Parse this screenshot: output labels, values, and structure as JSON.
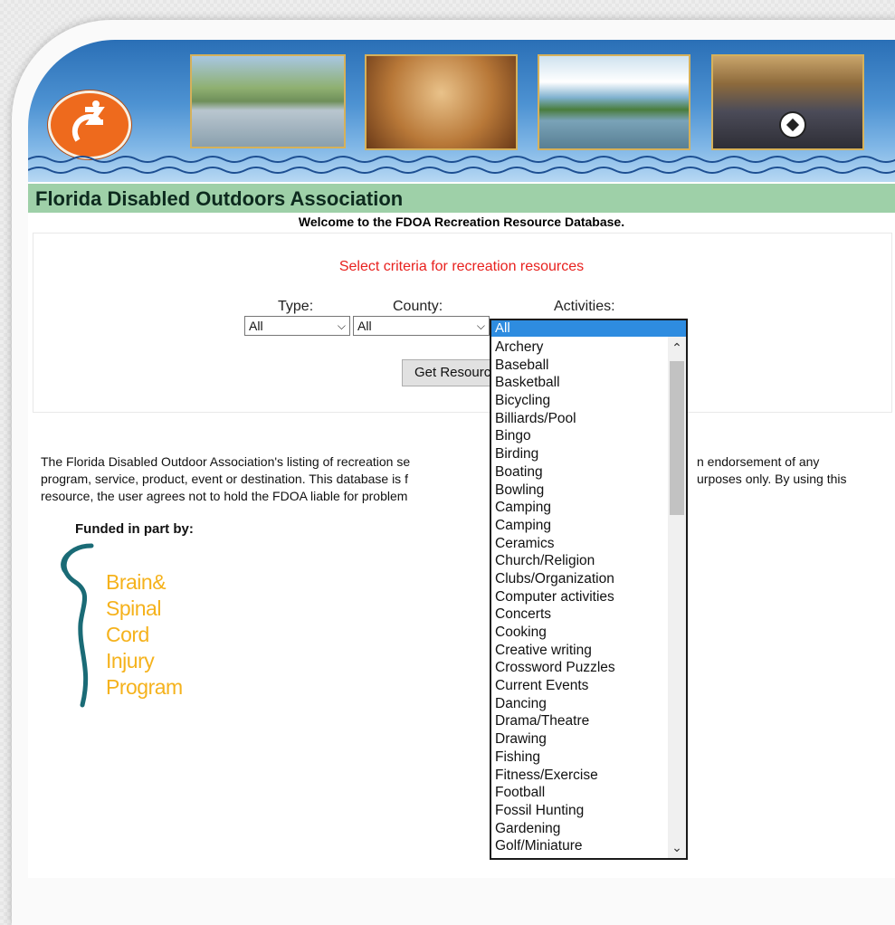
{
  "header": {
    "site_title": "Florida Disabled Outdoors Association",
    "welcome": "Welcome to the FDOA Recreation Resource Database."
  },
  "search": {
    "prompt": "Select criteria for recreation resources",
    "type_label": "Type:",
    "type_value": "All",
    "county_label": "County:",
    "county_value": "All",
    "activities_label": "Activities:",
    "button_label": "Get Resources"
  },
  "activities_dropdown": {
    "selected": "All",
    "items": [
      "Archery",
      "Baseball",
      "Basketball",
      "Bicycling",
      "Billiards/Pool",
      "Bingo",
      "Birding",
      "Boating",
      "Bowling",
      "Camping",
      "Camping",
      "Ceramics",
      "Church/Religion",
      "Clubs/Organization",
      "Computer activities",
      "Concerts",
      "Cooking",
      "Creative writing",
      "Crossword Puzzles",
      "Current Events",
      "Dancing",
      "Drama/Theatre",
      "Drawing",
      "Fishing",
      "Fitness/Exercise",
      "Football",
      "Fossil Hunting",
      "Gardening",
      "Golf/Miniature"
    ]
  },
  "disclaimer": {
    "line1_left": "The Florida Disabled Outdoor Association's listing of recreation se",
    "line1_right": "n endorsement of any",
    "line2_left": "program, service, product, event or destination. This database is f",
    "line2_right": "urposes only. By using this",
    "line3_left": "resource, the user agrees not to hold the FDOA liable for problem"
  },
  "funding": {
    "label": "Funded in part by:",
    "logo_lines": [
      "Brain&",
      "Spinal",
      "Cord",
      "Injury",
      "Program"
    ]
  },
  "colors": {
    "accent_title_strip": "#9ed0a8",
    "prompt_red": "#e8211e",
    "selected_blue": "#2e8ce0",
    "logo_orange": "#ee6a1d",
    "bscip_gold": "#f5b21c"
  },
  "icons": [
    "fdoa-logo-icon",
    "chevron-down-icon",
    "scroll-up-icon",
    "scroll-down-icon"
  ]
}
